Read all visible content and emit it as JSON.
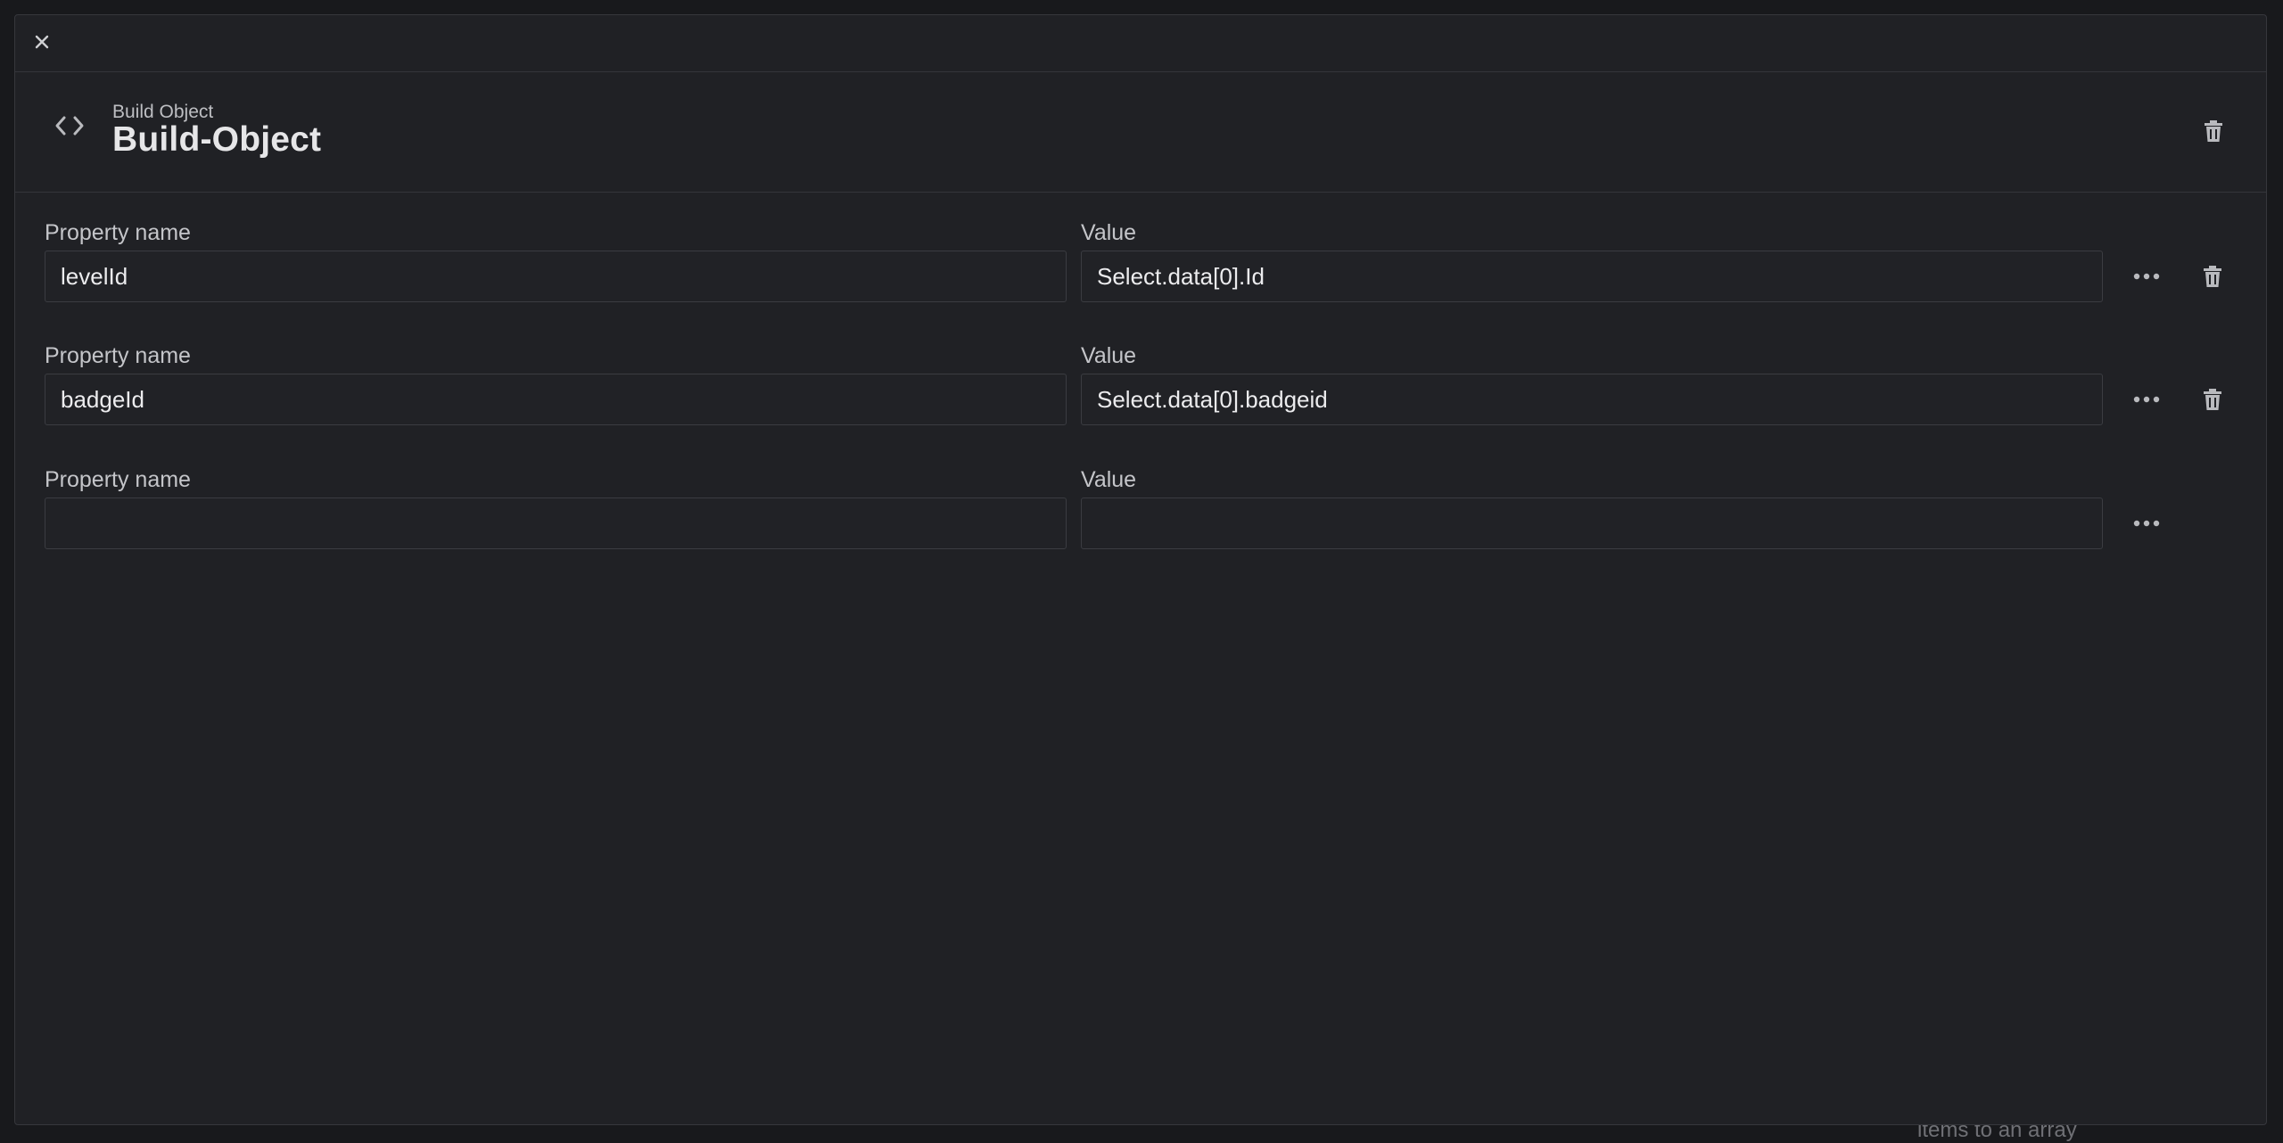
{
  "background": {
    "partial_text": "items to an array"
  },
  "modal": {
    "close_icon": "close-icon",
    "header": {
      "icon": "code-brackets-icon",
      "subtitle": "Build Object",
      "title": "Build-Object",
      "delete_icon": "trash-icon"
    },
    "rows": [
      {
        "name_label": "Property name",
        "value_label": "Value",
        "name_value": "levelId",
        "value_value": "Select.data[0].Id",
        "has_delete": true
      },
      {
        "name_label": "Property name",
        "value_label": "Value",
        "name_value": "badgeId",
        "value_value": "Select.data[0].badgeid",
        "has_delete": true
      },
      {
        "name_label": "Property name",
        "value_label": "Value",
        "name_value": "",
        "value_value": "",
        "has_delete": false
      }
    ]
  },
  "colors": {
    "modal_bg": "#202125",
    "input_border": "#3b3c41",
    "text_primary": "#e6e6e8",
    "text_secondary": "#c4c5c9",
    "icon": "#b9babe"
  }
}
